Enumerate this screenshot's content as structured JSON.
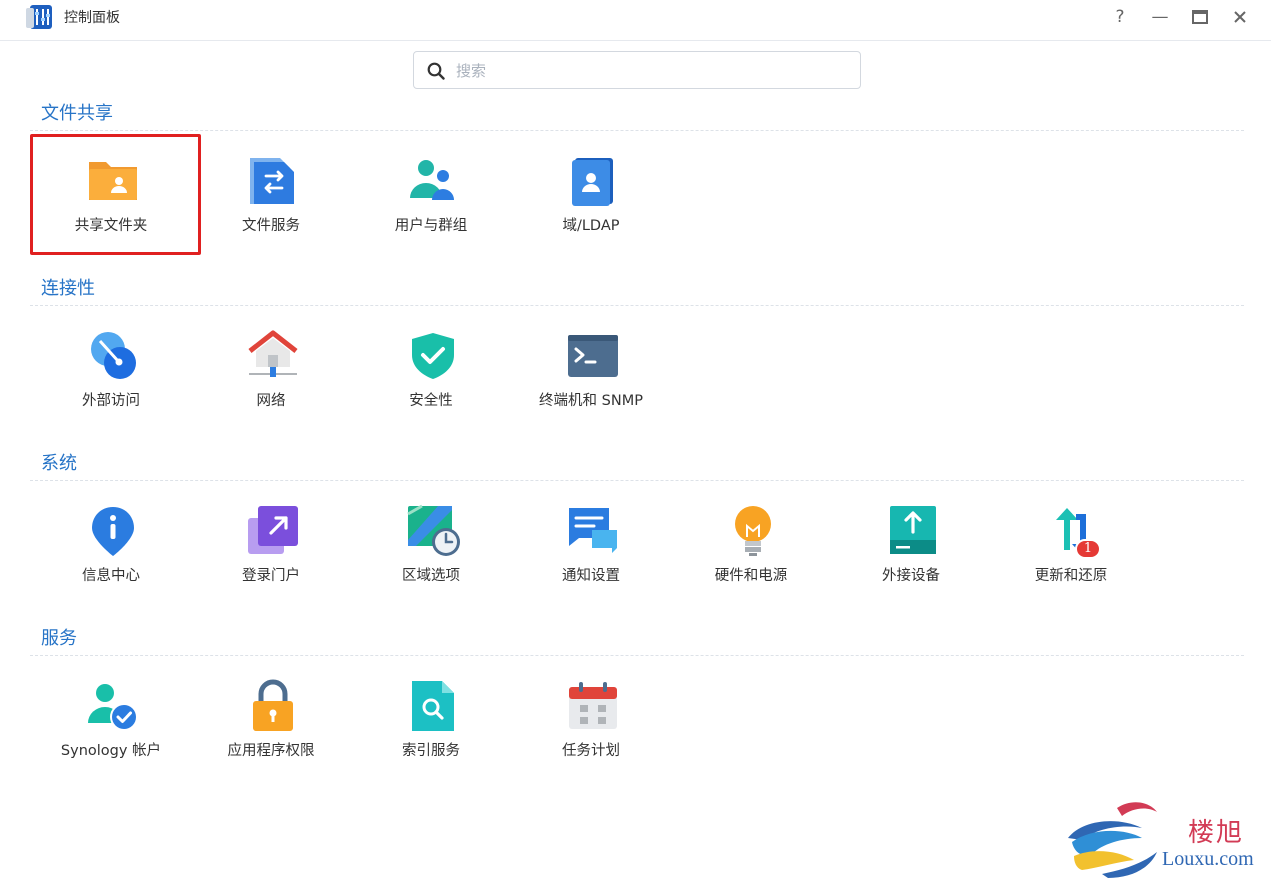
{
  "window": {
    "title": "控制面板",
    "help_glyph": "?",
    "minimize_glyph": "—",
    "maximize_glyph": "▬",
    "close_glyph": "✕"
  },
  "search": {
    "placeholder": "搜索",
    "value": ""
  },
  "sections": {
    "file_sharing": {
      "title": "文件共享",
      "items": [
        "共享文件夹",
        "文件服务",
        "用户与群组",
        "域/LDAP"
      ]
    },
    "connectivity": {
      "title": "连接性",
      "items": [
        "外部访问",
        "网络",
        "安全性",
        "终端机和 SNMP"
      ]
    },
    "system": {
      "title": "系统",
      "items": [
        "信息中心",
        "登录门户",
        "区域选项",
        "通知设置",
        "硬件和电源",
        "外接设备",
        "更新和还原"
      ],
      "update_badge": "1"
    },
    "services": {
      "title": "服务",
      "items": [
        "Synology 帐户",
        "应用程序权限",
        "索引服务",
        "任务计划"
      ]
    }
  },
  "icons": {
    "shared-folder": "folder-user-icon",
    "file-services": "file-transfer-icon",
    "users-groups": "users-icon",
    "domain-ldap": "address-book-icon",
    "external-access": "globe-icon",
    "network": "house-network-icon",
    "security": "shield-check-icon",
    "terminal-snmp": "terminal-icon",
    "info-center": "info-pin-icon",
    "login-portal": "portal-arrow-icon",
    "regional-options": "map-clock-icon",
    "notification": "chat-bubbles-icon",
    "hardware-power": "light-bulb-icon",
    "external-devices": "upload-drive-icon",
    "update-restore": "refresh-arrows-icon",
    "synology-account": "user-check-icon",
    "app-privileges": "padlock-icon",
    "indexing-service": "search-doc-icon",
    "task-scheduler": "calendar-icon"
  },
  "colors": {
    "section_title": "#2774c7",
    "highlight": "#e02020",
    "badge": "#e53935"
  },
  "watermark": {
    "cn": "楼旭",
    "en": "Louxu.com"
  }
}
